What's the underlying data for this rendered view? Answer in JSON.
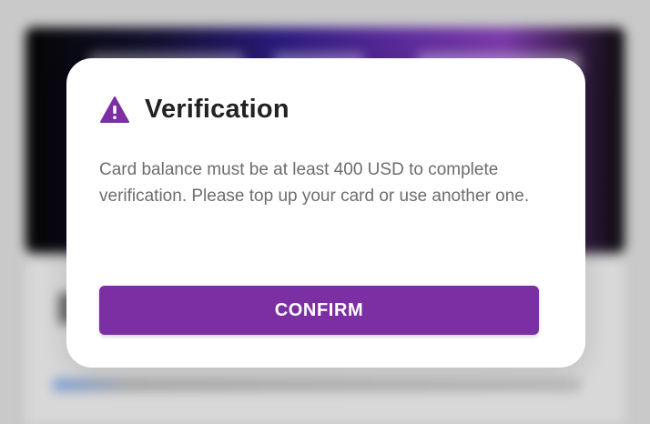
{
  "dialog": {
    "title": "Verification",
    "message": "Card balance must be at least 400 USD to complete verification. Please top up your card or use another one.",
    "confirm_label": "CONFIRM",
    "icon": "warning-icon"
  },
  "colors": {
    "accent": "#7b2fa3",
    "title_text": "#222222",
    "body_text": "#6d6d6d",
    "dialog_background": "#ffffff",
    "backdrop": "#c9c9c9"
  }
}
